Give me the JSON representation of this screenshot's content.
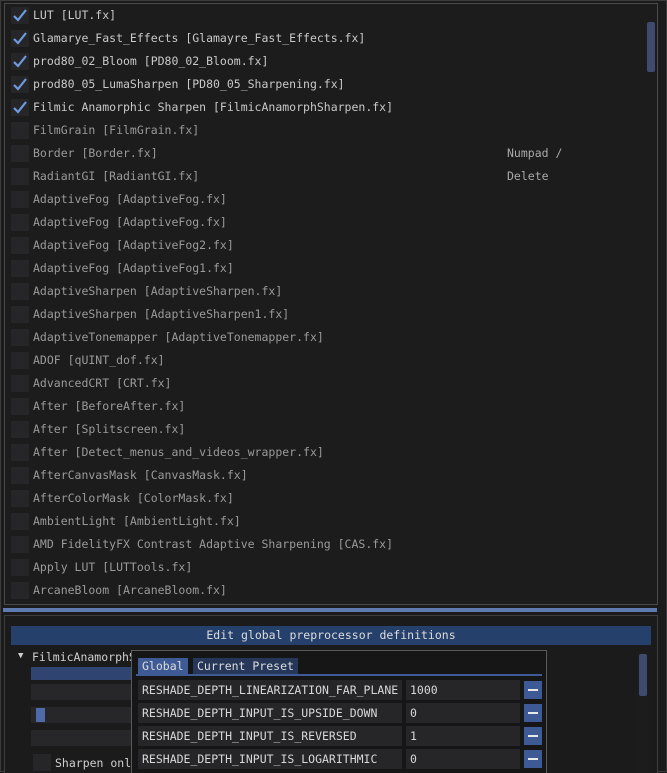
{
  "techniques": [
    {
      "label": "LUT [LUT.fx]",
      "enabled": true,
      "key": ""
    },
    {
      "label": "Glamarye_Fast_Effects [Glamayre_Fast_Effects.fx]",
      "enabled": true,
      "key": ""
    },
    {
      "label": "prod80_02_Bloom [PD80_02_Bloom.fx]",
      "enabled": true,
      "key": ""
    },
    {
      "label": "prod80_05_LumaSharpen [PD80_05_Sharpening.fx]",
      "enabled": true,
      "key": ""
    },
    {
      "label": "Filmic Anamorphic Sharpen [FilmicAnamorphSharpen.fx]",
      "enabled": true,
      "key": ""
    },
    {
      "label": "FilmGrain [FilmGrain.fx]",
      "enabled": false,
      "key": ""
    },
    {
      "label": "Border [Border.fx]",
      "enabled": false,
      "key": "Numpad /"
    },
    {
      "label": "RadiantGI [RadiantGI.fx]",
      "enabled": false,
      "key": "Delete"
    },
    {
      "label": "AdaptiveFog [AdaptiveFog.fx]",
      "enabled": false,
      "key": ""
    },
    {
      "label": "AdaptiveFog [AdaptiveFog.fx]",
      "enabled": false,
      "key": ""
    },
    {
      "label": "AdaptiveFog [AdaptiveFog2.fx]",
      "enabled": false,
      "key": ""
    },
    {
      "label": "AdaptiveFog [AdaptiveFog1.fx]",
      "enabled": false,
      "key": ""
    },
    {
      "label": "AdaptiveSharpen [AdaptiveSharpen.fx]",
      "enabled": false,
      "key": ""
    },
    {
      "label": "AdaptiveSharpen [AdaptiveSharpen1.fx]",
      "enabled": false,
      "key": ""
    },
    {
      "label": "AdaptiveTonemapper [AdaptiveTonemapper.fx]",
      "enabled": false,
      "key": ""
    },
    {
      "label": "ADOF [qUINT_dof.fx]",
      "enabled": false,
      "key": ""
    },
    {
      "label": "AdvancedCRT [CRT.fx]",
      "enabled": false,
      "key": ""
    },
    {
      "label": "After [BeforeAfter.fx]",
      "enabled": false,
      "key": ""
    },
    {
      "label": "After [Splitscreen.fx]",
      "enabled": false,
      "key": ""
    },
    {
      "label": "After [Detect_menus_and_videos_wrapper.fx]",
      "enabled": false,
      "key": ""
    },
    {
      "label": "AfterCanvasMask [CanvasMask.fx]",
      "enabled": false,
      "key": ""
    },
    {
      "label": "AfterColorMask [ColorMask.fx]",
      "enabled": false,
      "key": ""
    },
    {
      "label": "AmbientLight [AmbientLight.fx]",
      "enabled": false,
      "key": ""
    },
    {
      "label": "AMD FidelityFX Contrast Adaptive Sharpening [CAS.fx]",
      "enabled": false,
      "key": ""
    },
    {
      "label": "Apply LUT [LUTTools.fx]",
      "enabled": false,
      "key": ""
    },
    {
      "label": "ArcaneBloom [ArcaneBloom.fx]",
      "enabled": false,
      "key": ""
    }
  ],
  "lower": {
    "edit_global_label": "Edit global preprocessor definitions",
    "tree_label": "FilmicAnamorphSharpen",
    "sharpen_label": "Sharpen only"
  },
  "popup": {
    "tabs": [
      {
        "label": "Global",
        "active": true
      },
      {
        "label": "Current Preset",
        "active": false
      }
    ],
    "definitions": [
      {
        "name": "RESHADE_DEPTH_LINEARIZATION_FAR_PLANE",
        "value": "1000"
      },
      {
        "name": "RESHADE_DEPTH_INPUT_IS_UPSIDE_DOWN",
        "value": "0"
      },
      {
        "name": "RESHADE_DEPTH_INPUT_IS_REVERSED",
        "value": "1"
      },
      {
        "name": "RESHADE_DEPTH_INPUT_IS_LOGARITHMIC",
        "value": "0"
      }
    ]
  },
  "colors": {
    "accent": "#3e5b95",
    "check": "#6f9ae0",
    "splitter": "#5d7ab1"
  }
}
